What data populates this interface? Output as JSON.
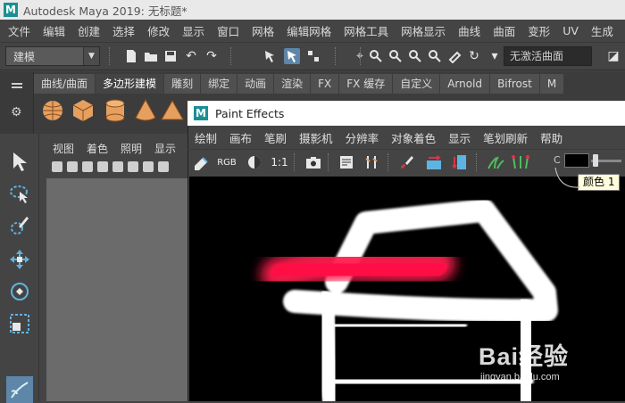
{
  "app": {
    "title": "Autodesk Maya 2019: 无标题*",
    "logo_letter": "M"
  },
  "menubar": [
    "文件",
    "编辑",
    "创建",
    "选择",
    "修改",
    "显示",
    "窗口",
    "网格",
    "编辑网格",
    "网格工具",
    "网格显示",
    "曲线",
    "曲面",
    "变形",
    "UV",
    "生成"
  ],
  "statusline": {
    "mode": "建模",
    "live_object": "无激活曲面"
  },
  "shelf": {
    "tabs": [
      "曲线/曲面",
      "多边形建模",
      "雕刻",
      "绑定",
      "动画",
      "渲染",
      "FX",
      "FX 缓存",
      "自定义",
      "Arnold",
      "Bifrost",
      "M"
    ],
    "active_tab": "多边形建模",
    "icons": [
      "sphere-icon",
      "cube-icon",
      "cylinder-icon",
      "cone-icon",
      "torus-icon"
    ]
  },
  "toolbox": [
    "select-tool-icon",
    "lasso-tool-icon",
    "paint-select-tool-icon",
    "move-tool-icon",
    "rotate-tool-icon",
    "scale-tool-icon",
    "paint-effects-tool-icon"
  ],
  "viewport": {
    "menu": [
      "视图",
      "着色",
      "照明",
      "显示"
    ]
  },
  "paint_effects": {
    "title": "Paint Effects",
    "menu": [
      "绘制",
      "画布",
      "笔刷",
      "摄影机",
      "分辨率",
      "对象着色",
      "显示",
      "笔划刷新",
      "帮助"
    ],
    "toolbar": {
      "rgb_label": "RGB",
      "zoom_label": "1:1",
      "color_prefix": "C"
    },
    "tooltip": "颜色 1",
    "colors": {
      "stroke_red": "#ff1f4e",
      "stroke_white": "#ffffff",
      "canvas": "#000000"
    }
  },
  "watermark": {
    "brand": "Bai经验",
    "site": "jingyan.baidu.com"
  }
}
